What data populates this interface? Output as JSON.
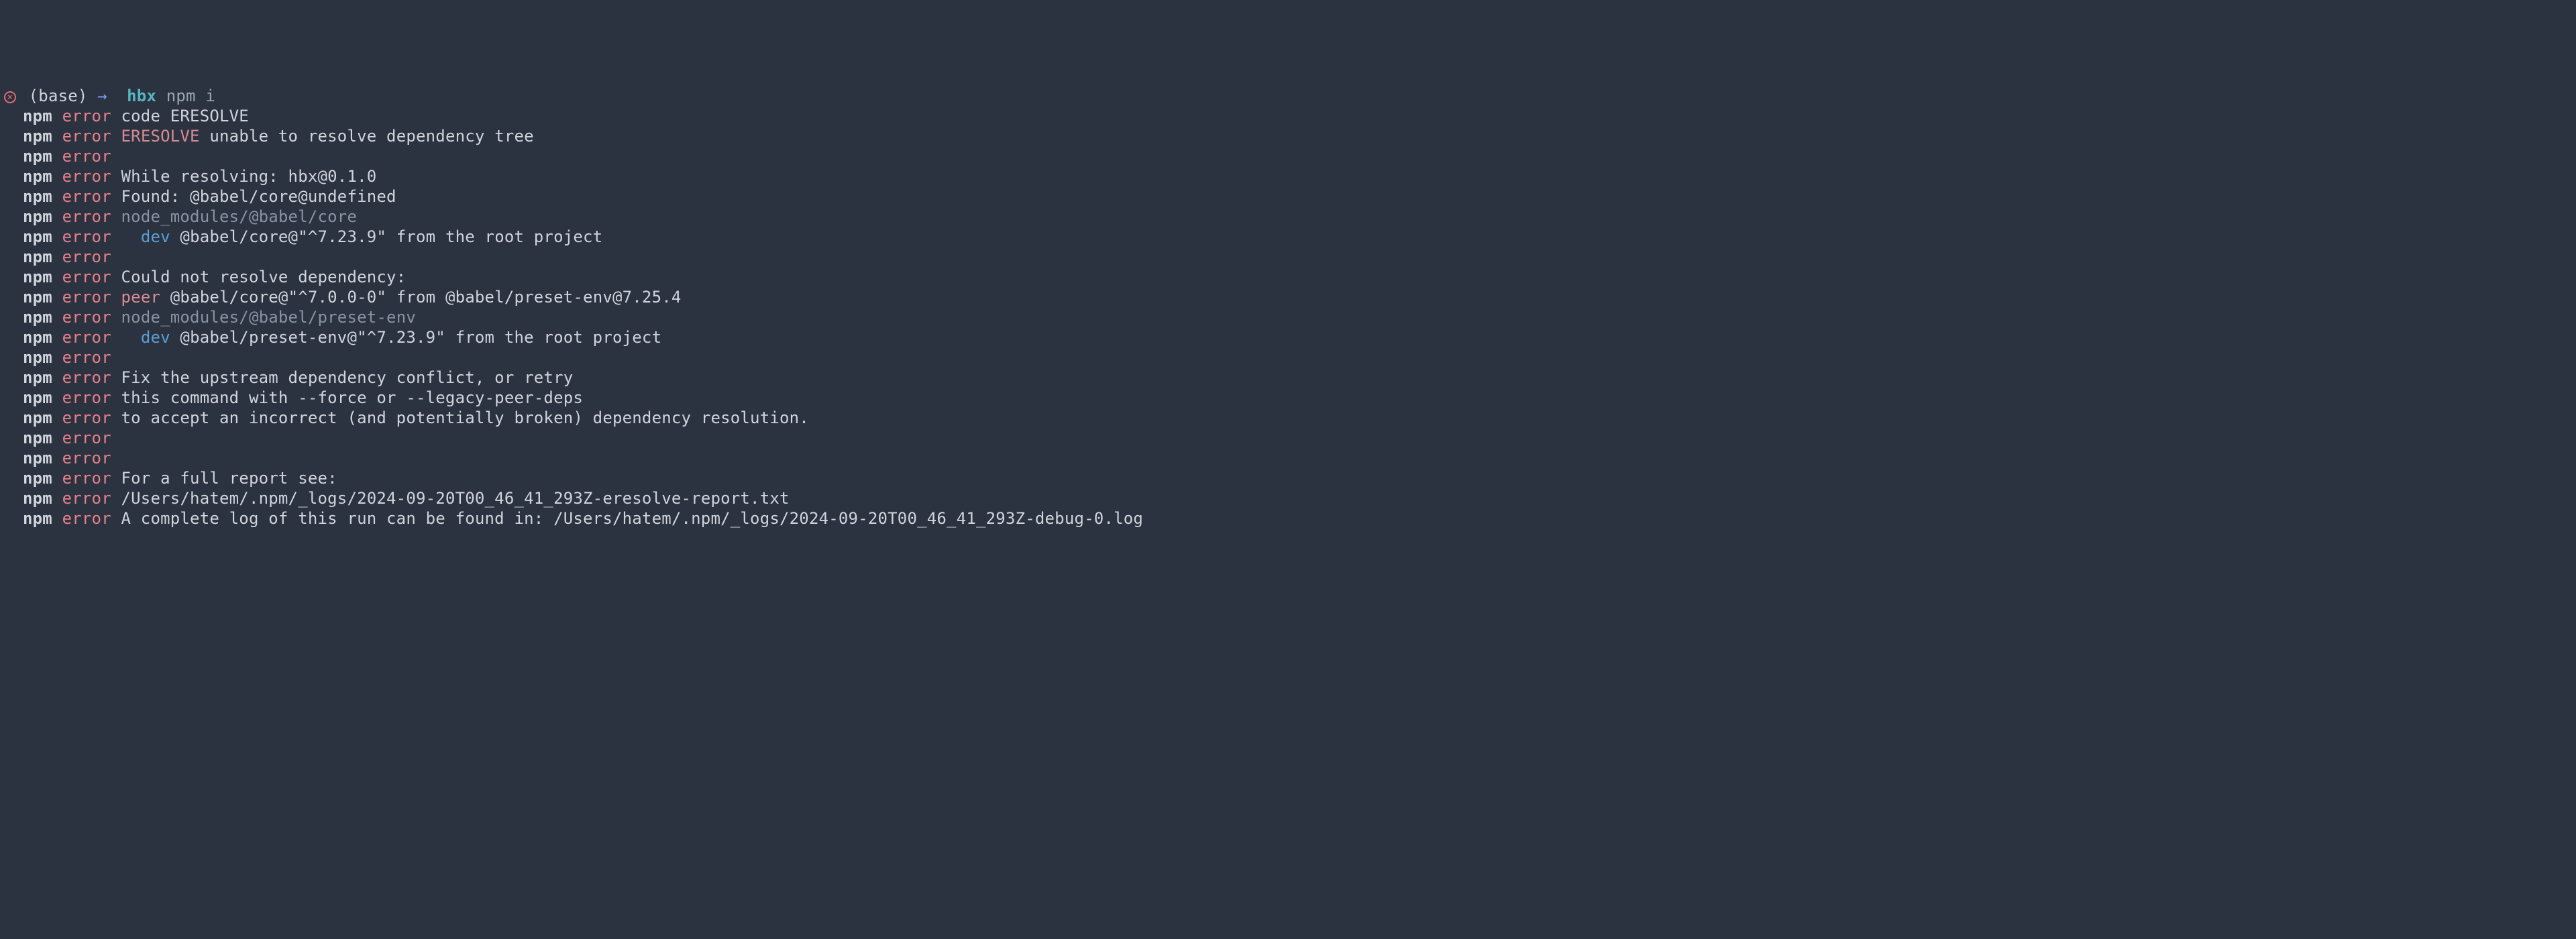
{
  "prompt": {
    "err_glyph": "×",
    "base": "(base)",
    "arrow": "→",
    "dir": "hbx",
    "command": "npm i"
  },
  "lines": [
    [
      {
        "cls": "npm",
        "t": "npm"
      },
      {
        "cls": "plain",
        "t": " "
      },
      {
        "cls": "error",
        "t": "error"
      },
      {
        "cls": "plain",
        "t": " code ERESOLVE"
      }
    ],
    [
      {
        "cls": "npm",
        "t": "npm"
      },
      {
        "cls": "plain",
        "t": " "
      },
      {
        "cls": "error",
        "t": "error"
      },
      {
        "cls": "plain",
        "t": " "
      },
      {
        "cls": "peer",
        "t": "ERESOLVE"
      },
      {
        "cls": "plain",
        "t": " unable to resolve dependency tree"
      }
    ],
    [
      {
        "cls": "npm",
        "t": "npm"
      },
      {
        "cls": "plain",
        "t": " "
      },
      {
        "cls": "error",
        "t": "error"
      }
    ],
    [
      {
        "cls": "npm",
        "t": "npm"
      },
      {
        "cls": "plain",
        "t": " "
      },
      {
        "cls": "error",
        "t": "error"
      },
      {
        "cls": "plain",
        "t": " While resolving: hbx@0.1.0"
      }
    ],
    [
      {
        "cls": "npm",
        "t": "npm"
      },
      {
        "cls": "plain",
        "t": " "
      },
      {
        "cls": "error",
        "t": "error"
      },
      {
        "cls": "plain",
        "t": " Found: @babel/core@undefined"
      }
    ],
    [
      {
        "cls": "npm",
        "t": "npm"
      },
      {
        "cls": "plain",
        "t": " "
      },
      {
        "cls": "error",
        "t": "error"
      },
      {
        "cls": "plain",
        "t": " "
      },
      {
        "cls": "path",
        "t": "node_modules/@babel/core"
      }
    ],
    [
      {
        "cls": "npm",
        "t": "npm"
      },
      {
        "cls": "plain",
        "t": " "
      },
      {
        "cls": "error",
        "t": "error"
      },
      {
        "cls": "plain",
        "t": "   "
      },
      {
        "cls": "dev",
        "t": "dev"
      },
      {
        "cls": "plain",
        "t": " @babel/core@\"^7.23.9\" from the root project"
      }
    ],
    [
      {
        "cls": "npm",
        "t": "npm"
      },
      {
        "cls": "plain",
        "t": " "
      },
      {
        "cls": "error",
        "t": "error"
      }
    ],
    [
      {
        "cls": "npm",
        "t": "npm"
      },
      {
        "cls": "plain",
        "t": " "
      },
      {
        "cls": "error",
        "t": "error"
      },
      {
        "cls": "plain",
        "t": " Could not resolve dependency:"
      }
    ],
    [
      {
        "cls": "npm",
        "t": "npm"
      },
      {
        "cls": "plain",
        "t": " "
      },
      {
        "cls": "error",
        "t": "error"
      },
      {
        "cls": "plain",
        "t": " "
      },
      {
        "cls": "peer",
        "t": "peer"
      },
      {
        "cls": "plain",
        "t": " @babel/core@\"^7.0.0-0\" from @babel/preset-env@7.25.4"
      }
    ],
    [
      {
        "cls": "npm",
        "t": "npm"
      },
      {
        "cls": "plain",
        "t": " "
      },
      {
        "cls": "error",
        "t": "error"
      },
      {
        "cls": "plain",
        "t": " "
      },
      {
        "cls": "path",
        "t": "node_modules/@babel/preset-env"
      }
    ],
    [
      {
        "cls": "npm",
        "t": "npm"
      },
      {
        "cls": "plain",
        "t": " "
      },
      {
        "cls": "error",
        "t": "error"
      },
      {
        "cls": "plain",
        "t": "   "
      },
      {
        "cls": "dev",
        "t": "dev"
      },
      {
        "cls": "plain",
        "t": " @babel/preset-env@\"^7.23.9\" from the root project"
      }
    ],
    [
      {
        "cls": "npm",
        "t": "npm"
      },
      {
        "cls": "plain",
        "t": " "
      },
      {
        "cls": "error",
        "t": "error"
      }
    ],
    [
      {
        "cls": "npm",
        "t": "npm"
      },
      {
        "cls": "plain",
        "t": " "
      },
      {
        "cls": "error",
        "t": "error"
      },
      {
        "cls": "plain",
        "t": " Fix the upstream dependency conflict, or retry"
      }
    ],
    [
      {
        "cls": "npm",
        "t": "npm"
      },
      {
        "cls": "plain",
        "t": " "
      },
      {
        "cls": "error",
        "t": "error"
      },
      {
        "cls": "plain",
        "t": " this command with --force or --legacy-peer-deps"
      }
    ],
    [
      {
        "cls": "npm",
        "t": "npm"
      },
      {
        "cls": "plain",
        "t": " "
      },
      {
        "cls": "error",
        "t": "error"
      },
      {
        "cls": "plain",
        "t": " to accept an incorrect (and potentially broken) dependency resolution."
      }
    ],
    [
      {
        "cls": "npm",
        "t": "npm"
      },
      {
        "cls": "plain",
        "t": " "
      },
      {
        "cls": "error",
        "t": "error"
      }
    ],
    [
      {
        "cls": "npm",
        "t": "npm"
      },
      {
        "cls": "plain",
        "t": " "
      },
      {
        "cls": "error",
        "t": "error"
      }
    ],
    [
      {
        "cls": "npm",
        "t": "npm"
      },
      {
        "cls": "plain",
        "t": " "
      },
      {
        "cls": "error",
        "t": "error"
      },
      {
        "cls": "plain",
        "t": " For a full report see:"
      }
    ],
    [
      {
        "cls": "npm",
        "t": "npm"
      },
      {
        "cls": "plain",
        "t": " "
      },
      {
        "cls": "error",
        "t": "error"
      },
      {
        "cls": "plain",
        "t": " /Users/hatem/.npm/_logs/2024-09-20T00_46_41_293Z-eresolve-report.txt"
      }
    ],
    [
      {
        "cls": "npm",
        "t": "npm"
      },
      {
        "cls": "plain",
        "t": " "
      },
      {
        "cls": "error",
        "t": "error"
      },
      {
        "cls": "plain",
        "t": " A complete log of this run can be found in: /Users/hatem/.npm/_logs/2024-09-20T00_46_41_293Z-debug-0.log"
      }
    ]
  ]
}
